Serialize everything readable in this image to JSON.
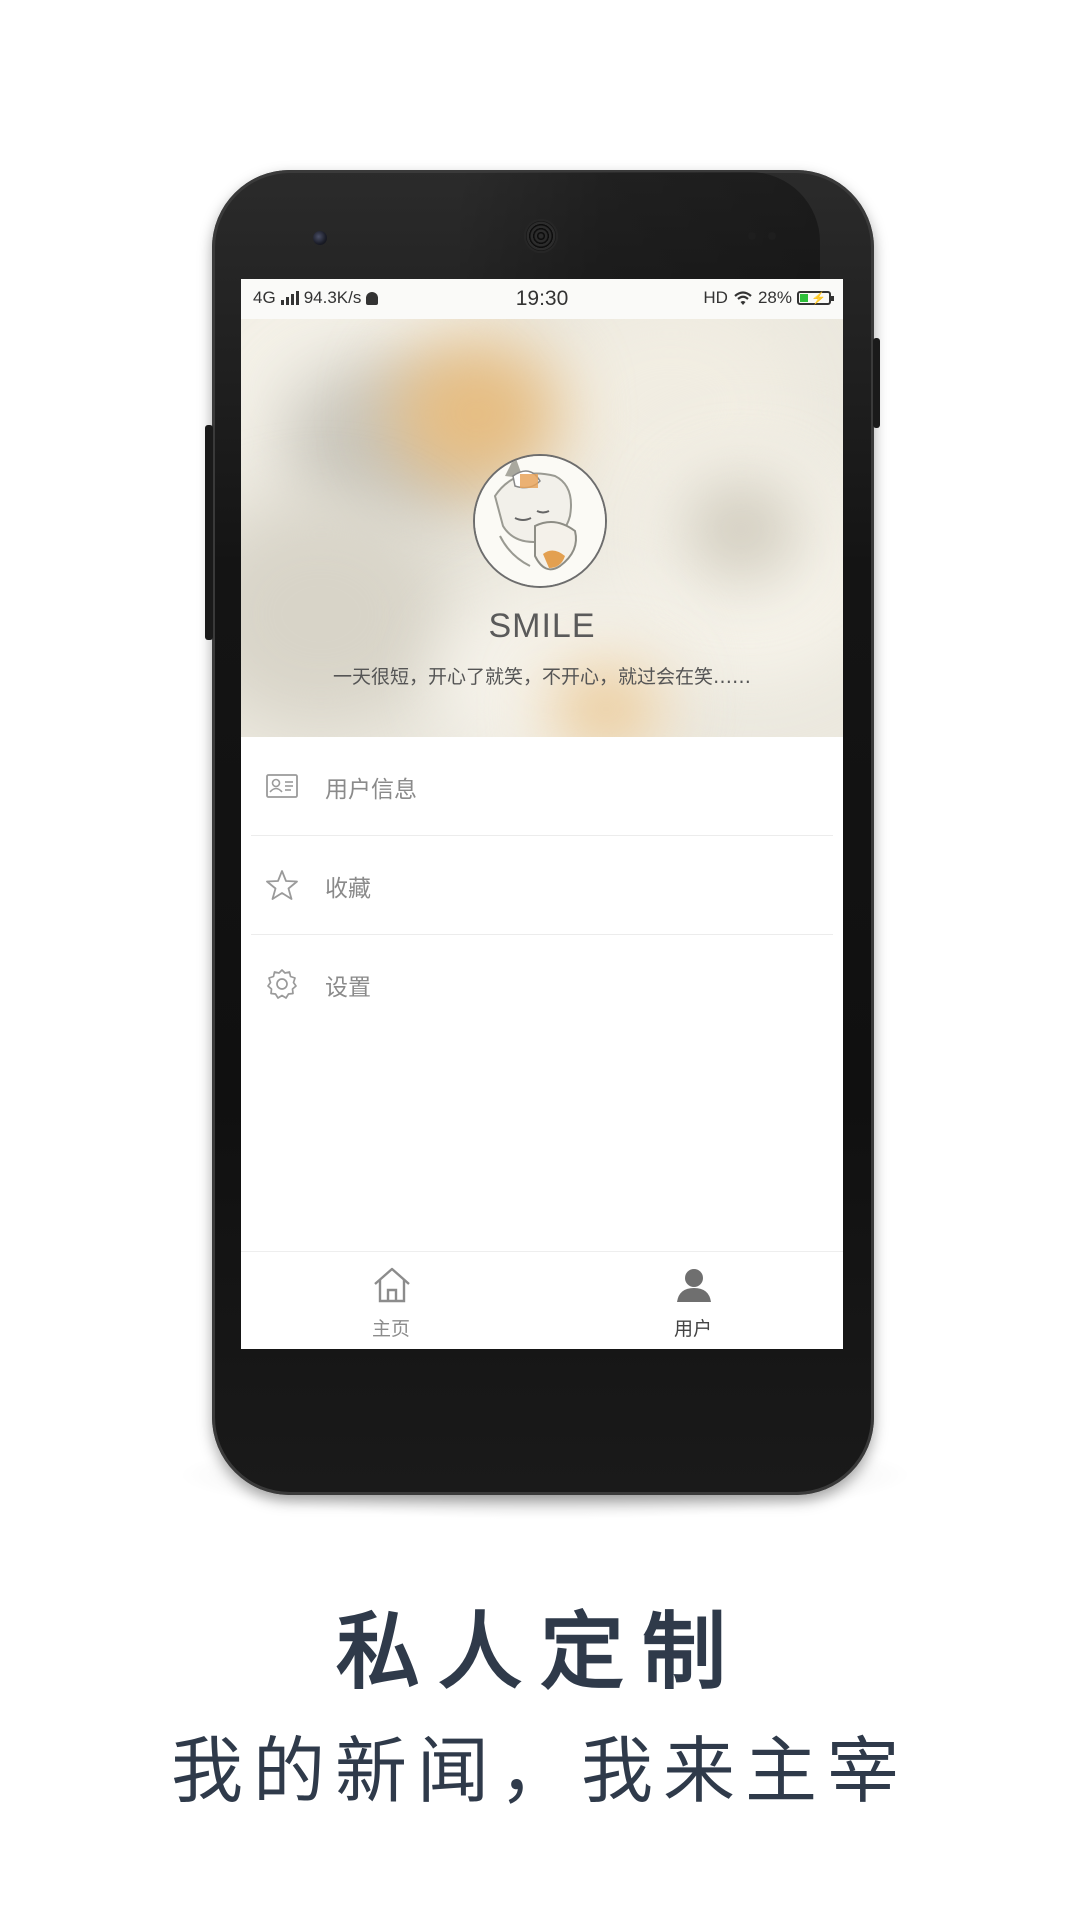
{
  "status_bar": {
    "network": "4G",
    "speed": "94.3K/s",
    "time": "19:30",
    "hd": "HD",
    "battery_percent": "28%",
    "battery_level": 0.28
  },
  "profile": {
    "name": "SMILE",
    "bio": "一天很短，开心了就笑，不开心，就过会在笑……"
  },
  "menu": {
    "items": [
      {
        "label": "用户信息",
        "icon": "user-card-icon"
      },
      {
        "label": "收藏",
        "icon": "star-icon"
      },
      {
        "label": "设置",
        "icon": "gear-icon"
      }
    ]
  },
  "bottom_nav": {
    "tabs": [
      {
        "label": "主页",
        "icon": "home-icon",
        "active": false
      },
      {
        "label": "用户",
        "icon": "user-icon",
        "active": true
      }
    ]
  },
  "caption": {
    "title": "私人定制",
    "subtitle": "我的新闻，我来主宰"
  },
  "colors": {
    "phone_body": "#141414",
    "caption_text": "#2f3a4a",
    "menu_text": "#8a8a8a",
    "battery_fill": "#2fbf3a"
  }
}
